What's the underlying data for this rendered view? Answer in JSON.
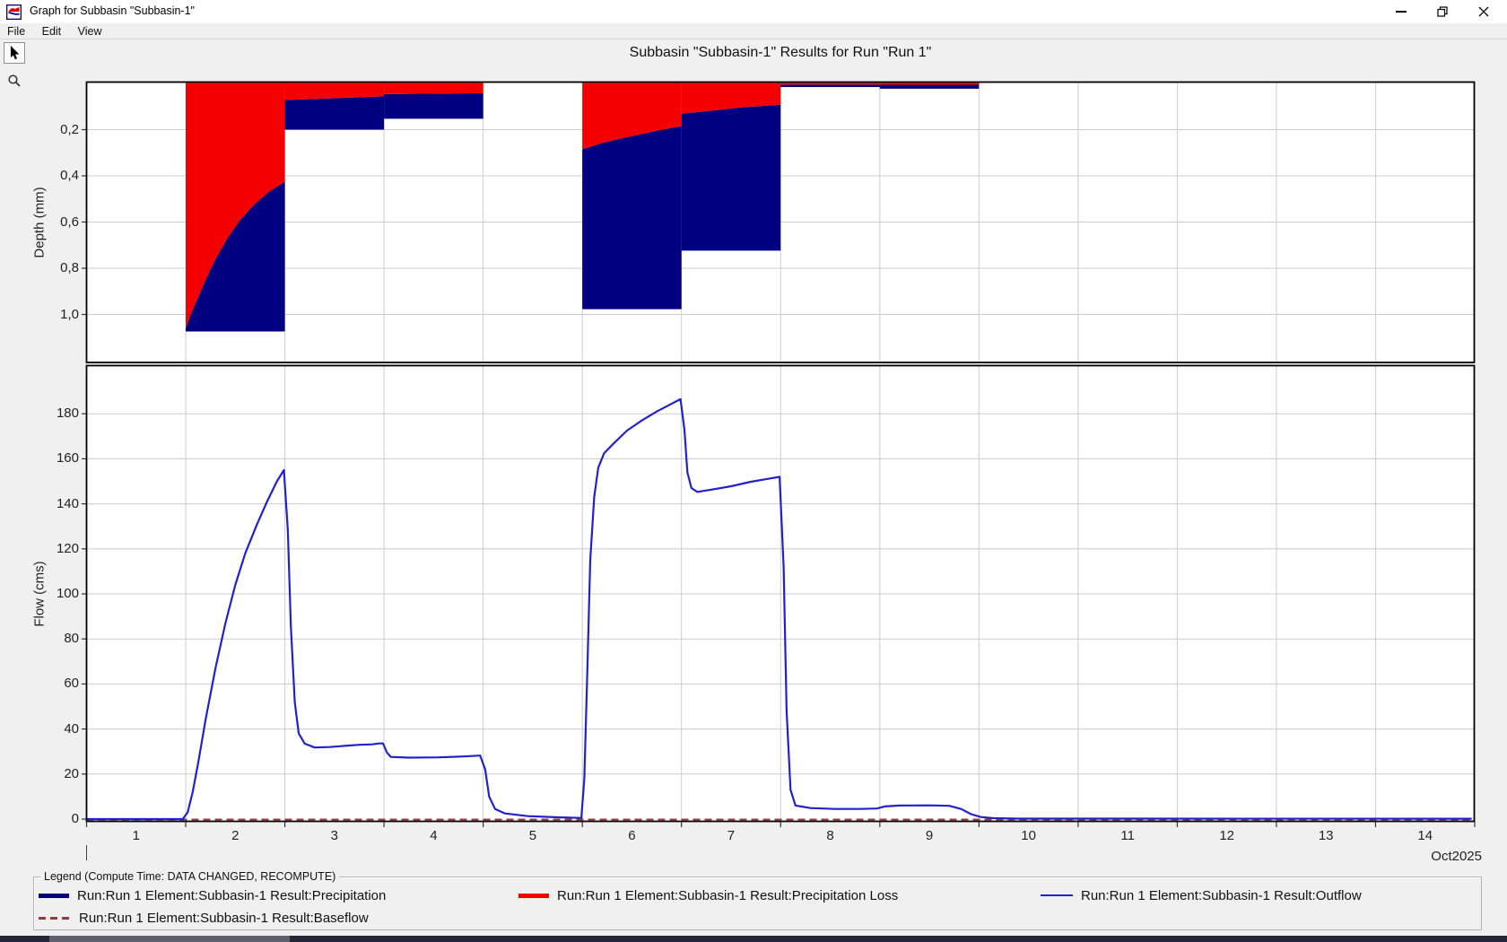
{
  "window": {
    "title": "Graph for Subbasin \"Subbasin-1\"",
    "menu_items": [
      "File",
      "Edit",
      "View"
    ],
    "icons": {
      "app_icon": "hms-graph-icon",
      "toolbar": [
        "arrow-select-cursor",
        "magnifier-zoom"
      ],
      "controls": [
        "minimize",
        "restore",
        "close"
      ]
    }
  },
  "colors": {
    "precipitation": "#000080",
    "precipitation_loss": "#f40000",
    "outflow": "#2121cd",
    "baseflow": "#963c3c",
    "grid": "#cccccc",
    "plot_border": "#000000",
    "plot_background": "#ffffff",
    "window_background": "#f0f0f0"
  },
  "chart_data": {
    "type": "combo",
    "title": "Subbasin \"Subbasin-1\" Results for Run \"Run 1\"",
    "x_axis": {
      "unit": "day of month",
      "day_labels": [
        "1",
        "2",
        "3",
        "4",
        "5",
        "6",
        "7",
        "8",
        "9",
        "10",
        "11",
        "12",
        "13",
        "14"
      ],
      "month_label": "Oct2025",
      "min_day": 1,
      "max_day": 15,
      "gridline_days": [
        2,
        3,
        4,
        5,
        6,
        7,
        8,
        9,
        10,
        11,
        12,
        13,
        14
      ]
    },
    "precipitation_chart": {
      "type": "bar-inverted-stacked",
      "ylabel": "Depth (mm)",
      "ylim": [
        0,
        1.21
      ],
      "yticks": [
        {
          "v": 0.2,
          "label": "0,2"
        },
        {
          "v": 0.4,
          "label": "0,4"
        },
        {
          "v": 0.6,
          "label": "0,6"
        },
        {
          "v": 0.8,
          "label": "0,8"
        },
        {
          "v": 1.0,
          "label": "1,0"
        }
      ],
      "series_note": "each segment: total precipitation depth (navy) with loss portion (red) from 0 down to loss boundary",
      "segments": [
        {
          "t0": 2.0,
          "t1": 3.0,
          "total": 1.074,
          "loss": [
            [
              2.0,
              1.06
            ],
            [
              2.05,
              1.0
            ],
            [
              2.12,
              0.93
            ],
            [
              2.2,
              0.85
            ],
            [
              2.3,
              0.76
            ],
            [
              2.42,
              0.67
            ],
            [
              2.55,
              0.59
            ],
            [
              2.7,
              0.52
            ],
            [
              2.85,
              0.465
            ],
            [
              3.0,
              0.425
            ]
          ]
        },
        {
          "t0": 3.0,
          "t1": 4.0,
          "total": 0.2,
          "loss": [
            [
              3.0,
              0.072
            ],
            [
              3.5,
              0.064
            ],
            [
              4.0,
              0.056
            ]
          ]
        },
        {
          "t0": 4.0,
          "t1": 5.0,
          "total": 0.153,
          "loss": [
            [
              4.0,
              0.046
            ],
            [
              4.5,
              0.044
            ],
            [
              5.0,
              0.042
            ]
          ]
        },
        {
          "t0": 6.0,
          "t1": 7.0,
          "total": 0.977,
          "loss": [
            [
              6.0,
              0.285
            ],
            [
              6.2,
              0.258
            ],
            [
              6.4,
              0.237
            ],
            [
              6.6,
              0.219
            ],
            [
              6.8,
              0.2
            ],
            [
              7.0,
              0.185
            ]
          ]
        },
        {
          "t0": 7.0,
          "t1": 8.0,
          "total": 0.724,
          "loss": [
            [
              7.0,
              0.131
            ],
            [
              7.3,
              0.118
            ],
            [
              7.6,
              0.104
            ],
            [
              8.0,
              0.092
            ]
          ]
        },
        {
          "t0": 8.0,
          "t1": 9.0,
          "total": 0.0155,
          "loss": [
            [
              8.0,
              0.005
            ],
            [
              9.0,
              0.005
            ]
          ]
        },
        {
          "t0": 9.0,
          "t1": 10.0,
          "total": 0.023,
          "loss": [
            [
              9.0,
              0.006
            ],
            [
              10.0,
              0.006
            ]
          ]
        }
      ]
    },
    "flow_chart": {
      "type": "line",
      "ylabel": "Flow (cms)",
      "ylim": [
        0,
        202
      ],
      "yticks": [
        {
          "v": 0,
          "label": "0"
        },
        {
          "v": 20,
          "label": "20"
        },
        {
          "v": 40,
          "label": "40"
        },
        {
          "v": 60,
          "label": "60"
        },
        {
          "v": 80,
          "label": "80"
        },
        {
          "v": 100,
          "label": "100"
        },
        {
          "v": 120,
          "label": "120"
        },
        {
          "v": 140,
          "label": "140"
        },
        {
          "v": 160,
          "label": "160"
        },
        {
          "v": 180,
          "label": "180"
        }
      ],
      "outflow_points": [
        [
          1.0,
          0
        ],
        [
          1.97,
          0
        ],
        [
          2.02,
          3
        ],
        [
          2.07,
          12
        ],
        [
          2.13,
          26
        ],
        [
          2.2,
          44
        ],
        [
          2.3,
          67
        ],
        [
          2.4,
          87
        ],
        [
          2.5,
          104
        ],
        [
          2.6,
          118
        ],
        [
          2.72,
          131
        ],
        [
          2.82,
          141
        ],
        [
          2.92,
          150
        ],
        [
          2.99,
          155
        ],
        [
          3.03,
          128
        ],
        [
          3.06,
          86
        ],
        [
          3.1,
          52
        ],
        [
          3.14,
          38
        ],
        [
          3.2,
          33.5
        ],
        [
          3.3,
          31.8
        ],
        [
          3.45,
          32
        ],
        [
          3.6,
          32.5
        ],
        [
          3.75,
          33
        ],
        [
          3.88,
          33.2
        ],
        [
          3.95,
          33.6
        ],
        [
          3.99,
          33.6
        ],
        [
          4.03,
          29.5
        ],
        [
          4.07,
          27.6
        ],
        [
          4.25,
          27.3
        ],
        [
          4.55,
          27.4
        ],
        [
          4.8,
          27.8
        ],
        [
          4.97,
          28.2
        ],
        [
          5.02,
          22
        ],
        [
          5.06,
          10
        ],
        [
          5.12,
          4.5
        ],
        [
          5.22,
          2.5
        ],
        [
          5.45,
          1.3
        ],
        [
          5.75,
          0.8
        ],
        [
          5.99,
          0.5
        ],
        [
          6.02,
          18
        ],
        [
          6.05,
          65
        ],
        [
          6.08,
          115
        ],
        [
          6.12,
          143
        ],
        [
          6.16,
          156
        ],
        [
          6.22,
          162.5
        ],
        [
          6.32,
          167
        ],
        [
          6.45,
          172.5
        ],
        [
          6.6,
          177
        ],
        [
          6.75,
          181
        ],
        [
          6.88,
          184
        ],
        [
          6.99,
          186.5
        ],
        [
          7.03,
          173
        ],
        [
          7.06,
          154
        ],
        [
          7.1,
          147
        ],
        [
          7.16,
          145.3
        ],
        [
          7.3,
          146.3
        ],
        [
          7.5,
          147.8
        ],
        [
          7.7,
          149.8
        ],
        [
          7.9,
          151.3
        ],
        [
          7.99,
          152
        ],
        [
          8.03,
          112
        ],
        [
          8.06,
          48
        ],
        [
          8.1,
          13
        ],
        [
          8.15,
          6
        ],
        [
          8.3,
          4.9
        ],
        [
          8.55,
          4.5
        ],
        [
          8.8,
          4.5
        ],
        [
          8.97,
          4.7
        ],
        [
          9.05,
          5.6
        ],
        [
          9.2,
          6
        ],
        [
          9.5,
          6.1
        ],
        [
          9.7,
          5.9
        ],
        [
          9.82,
          4.5
        ],
        [
          9.92,
          2.2
        ],
        [
          10.02,
          0.9
        ],
        [
          10.15,
          0.4
        ],
        [
          10.4,
          0.2
        ],
        [
          14.97,
          0.15
        ]
      ],
      "baseflow_value": 0
    }
  },
  "legend": {
    "title": "Legend (Compute Time: DATA CHANGED, RECOMPUTE)",
    "entries": [
      {
        "swatch": "precipitation",
        "label": "Run:Run 1 Element:Subbasin-1 Result:Precipitation"
      },
      {
        "swatch": "precipitation-loss",
        "label": "Run:Run 1 Element:Subbasin-1 Result:Precipitation Loss"
      },
      {
        "swatch": "outflow",
        "label": "Run:Run 1 Element:Subbasin-1 Result:Outflow"
      },
      {
        "swatch": "baseflow",
        "label": "Run:Run 1 Element:Subbasin-1 Result:Baseflow"
      }
    ]
  }
}
